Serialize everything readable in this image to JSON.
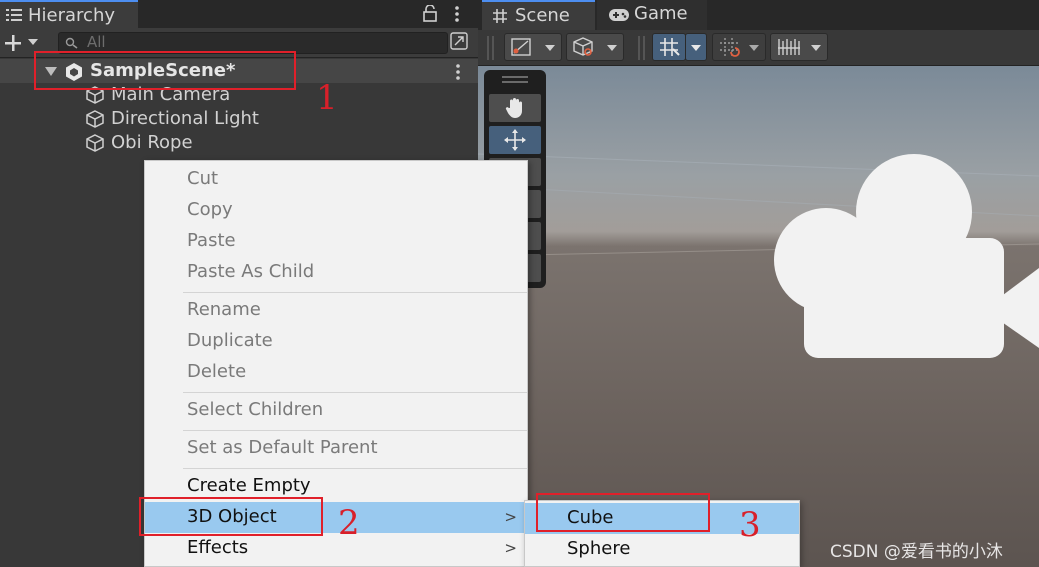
{
  "hierarchy": {
    "title": "Hierarchy",
    "search_placeholder": "All",
    "scene_name": "SampleScene*",
    "items": [
      {
        "label": "Main Camera"
      },
      {
        "label": "Directional Light"
      },
      {
        "label": "Obi Rope"
      }
    ]
  },
  "scene_view": {
    "tabs": [
      {
        "label": "Scene"
      },
      {
        "label": "Game"
      }
    ]
  },
  "context_menu": {
    "items": [
      {
        "label": "Cut",
        "enabled": false
      },
      {
        "label": "Copy",
        "enabled": false
      },
      {
        "label": "Paste",
        "enabled": false
      },
      {
        "label": "Paste As Child",
        "enabled": false
      },
      {
        "label": "Rename",
        "enabled": false
      },
      {
        "label": "Duplicate",
        "enabled": false
      },
      {
        "label": "Delete",
        "enabled": false
      },
      {
        "label": "Select Children",
        "enabled": false
      },
      {
        "label": "Set as Default Parent",
        "enabled": false
      },
      {
        "label": "Create Empty",
        "enabled": true
      },
      {
        "label": "3D Object",
        "enabled": true,
        "highlighted": true,
        "submenu": true
      },
      {
        "label": "Effects",
        "enabled": true,
        "submenu": true
      }
    ],
    "submenu_arrow": ">"
  },
  "submenu": {
    "items": [
      {
        "label": "Cube",
        "highlighted": true
      },
      {
        "label": "Sphere"
      }
    ]
  },
  "annotations": {
    "step1": "1",
    "step2": "2",
    "step3": "3",
    "color": "#e0202a"
  },
  "watermark": "CSDN @爱看书的小沐",
  "colors": {
    "accent": "#4d8ef0",
    "menu_highlight": "#99c9ef"
  }
}
